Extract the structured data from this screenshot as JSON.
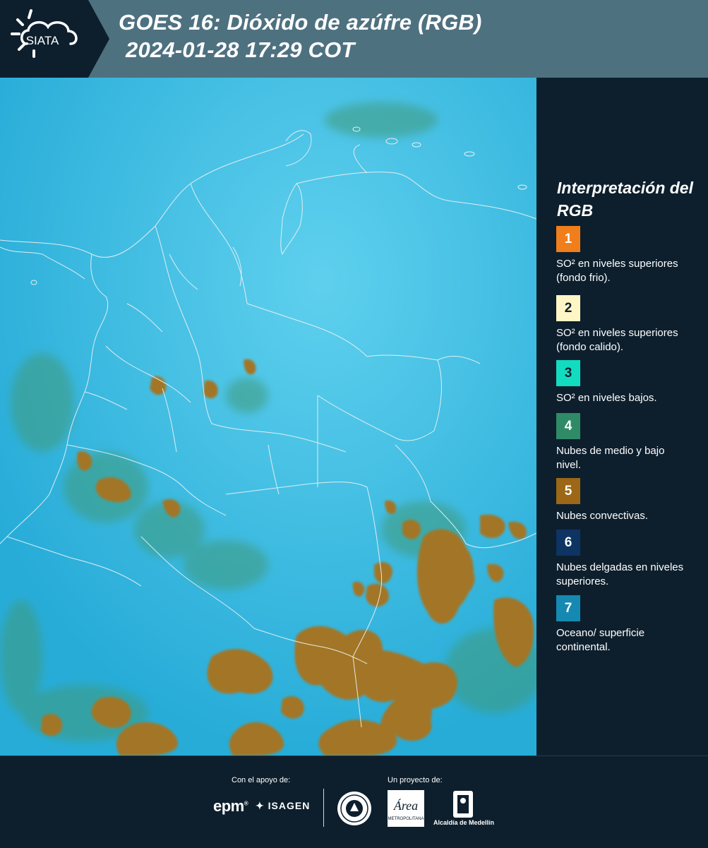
{
  "header": {
    "title_line1": "GOES 16: Dióxido de azúfre (RGB)",
    "title_line2": "2024-01-28 17:29 COT",
    "logo_text": "SIATA",
    "logo_icon": "sun-cloud-icon",
    "background_color": "#4e7180",
    "logo_background_color": "#0d1f2d"
  },
  "map": {
    "type": "satellite-rgb-composite",
    "colors": {
      "surface": "#2fb6df",
      "convective_cloud": "#a0762a",
      "mid_low_cloud": "#3d8f6e",
      "boundary_line": "#e8f0f2"
    }
  },
  "legend": {
    "title": "Interpretación del RGB",
    "items": [
      {
        "number": "1",
        "color": "#f07e1b",
        "label": "SO² en niveles superiores (fondo frio)."
      },
      {
        "number": "2",
        "color": "#fff6c5",
        "label": "SO² en niveles superiores (fondo calido)."
      },
      {
        "number": "3",
        "color": "#12dcc0",
        "label": "SO² en niveles bajos."
      },
      {
        "number": "4",
        "color": "#2f8b66",
        "label": "Nubes de medio y bajo nivel."
      },
      {
        "number": "5",
        "color": "#9c6716",
        "label": "Nubes convectivas."
      },
      {
        "number": "6",
        "color": "#0d3462",
        "label": "Nubes delgadas en niveles superiores."
      },
      {
        "number": "7",
        "color": "#1589b2",
        "label": "Oceano/ superficie continental."
      }
    ]
  },
  "footer": {
    "support_label": "Con el apoyo de:",
    "project_label": "Un proyecto de:",
    "sponsors": [
      "epm",
      "ISAGEN"
    ],
    "partners": [
      "Área Metropolitana",
      "Alcaldía de Medellín"
    ],
    "alcaldia_text": "Alcaldía de Medellín",
    "area_text": "Área",
    "area_subtext": "METROPOLITANA"
  }
}
